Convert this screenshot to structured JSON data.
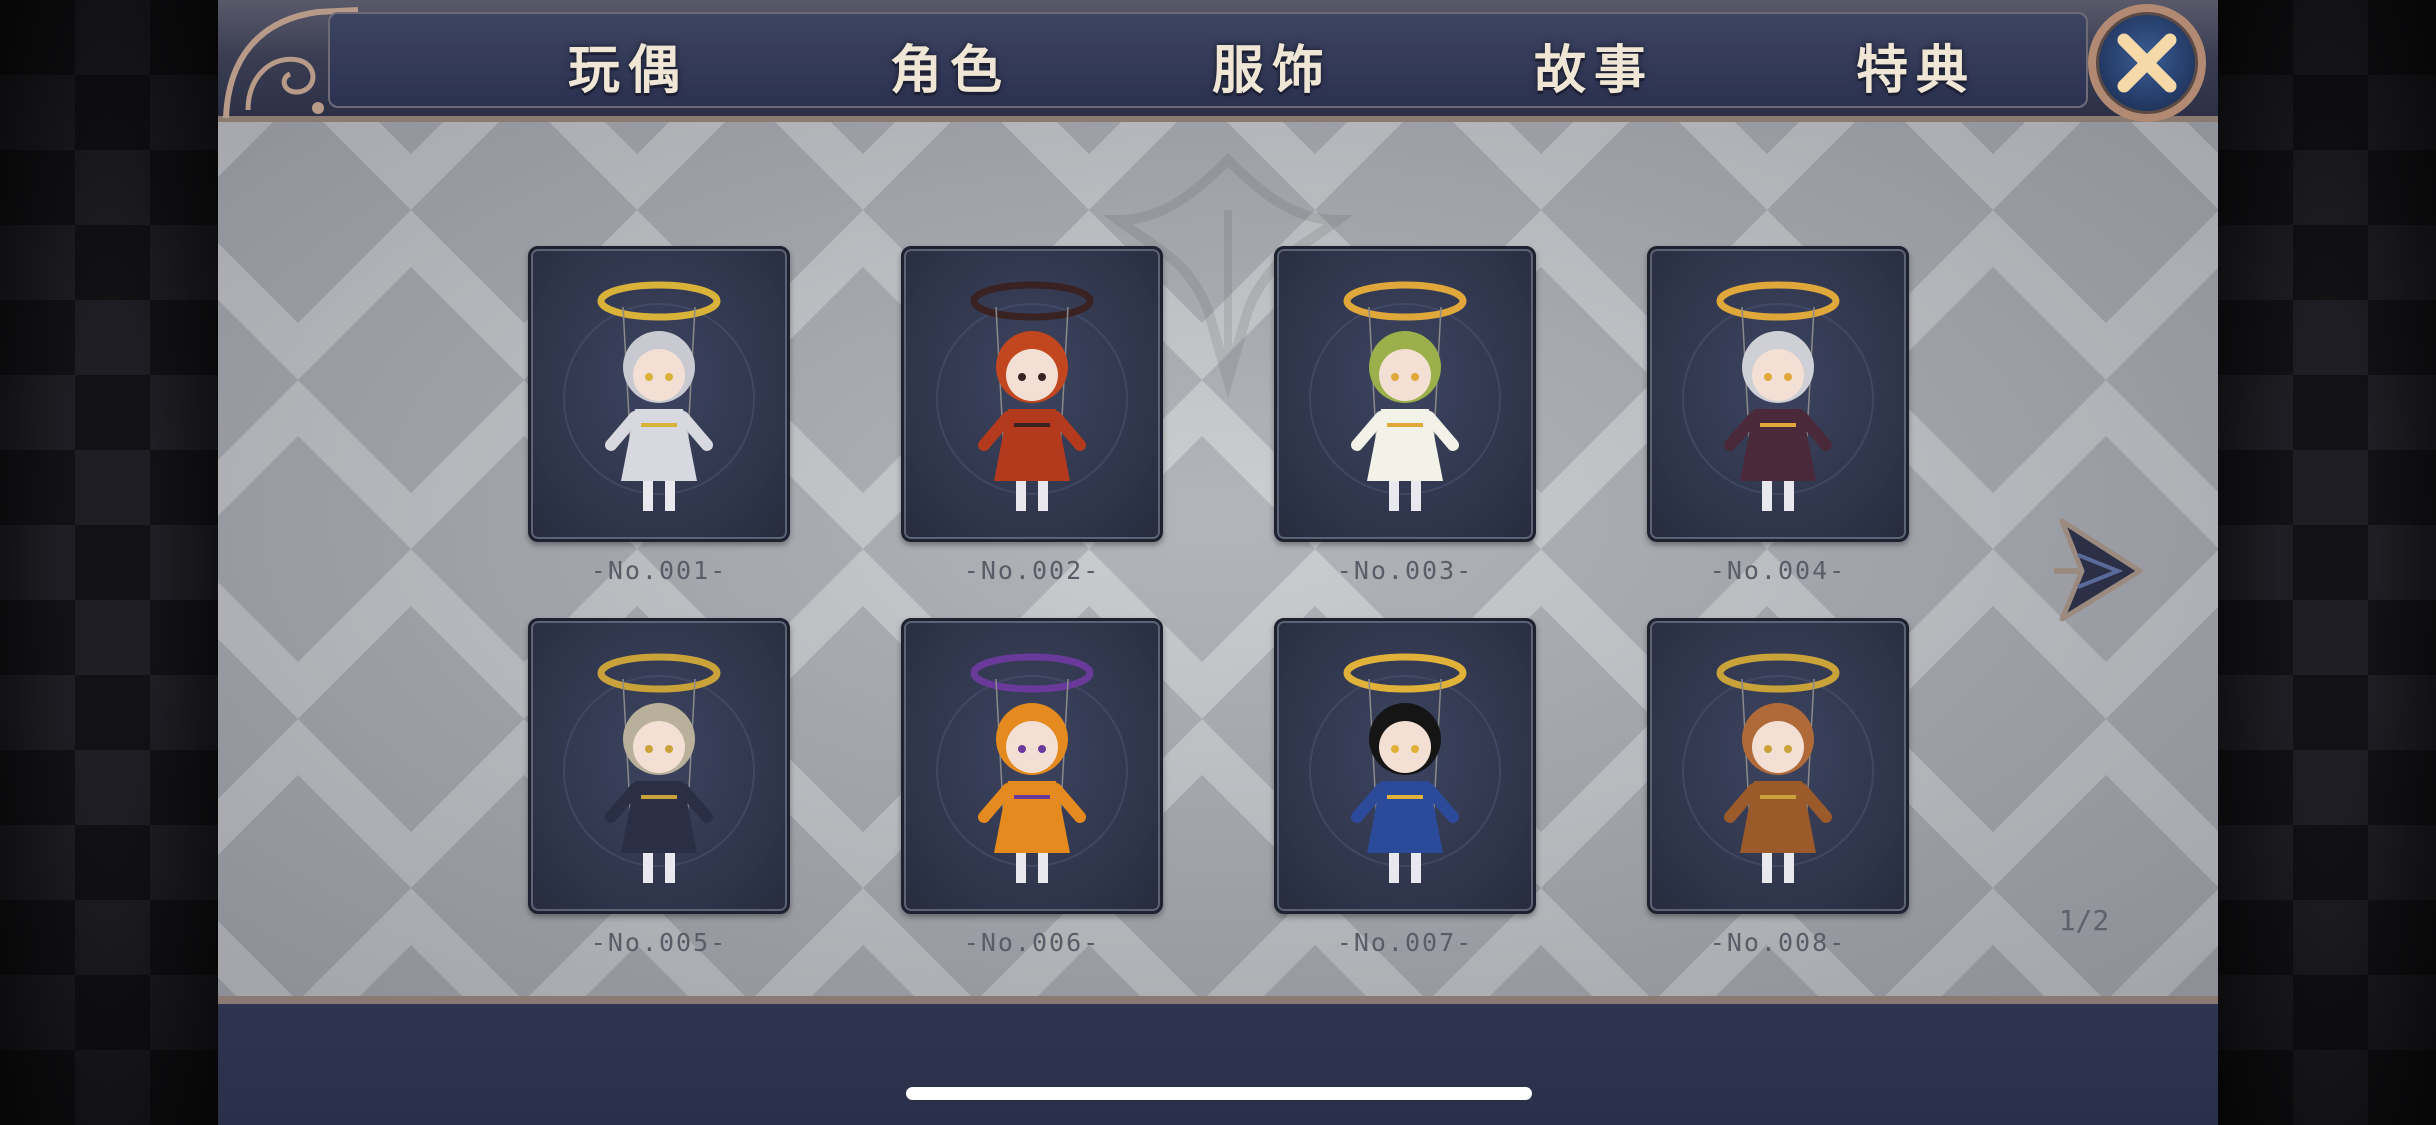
{
  "tabs": [
    {
      "label": "玩偶"
    },
    {
      "label": "角色"
    },
    {
      "label": "服饰"
    },
    {
      "label": "故事"
    },
    {
      "label": "特典"
    }
  ],
  "close_icon": "close-icon",
  "dolls": [
    {
      "label": "-No.001-",
      "palette": {
        "main": "#d8d8e0",
        "accent": "#d9b23a",
        "hair": "#c9c9d2"
      }
    },
    {
      "label": "-No.002-",
      "palette": {
        "main": "#b33a1c",
        "accent": "#3a2222",
        "hair": "#c2461f"
      }
    },
    {
      "label": "-No.003-",
      "palette": {
        "main": "#f2f2e8",
        "accent": "#e0a83a",
        "hair": "#9bb04a"
      }
    },
    {
      "label": "-No.004-",
      "palette": {
        "main": "#4a2a3a",
        "accent": "#e0a83a",
        "hair": "#cfcfd6"
      }
    },
    {
      "label": "-No.005-",
      "palette": {
        "main": "#2b2f45",
        "accent": "#c9a23a",
        "hair": "#b8b09a"
      }
    },
    {
      "label": "-No.006-",
      "palette": {
        "main": "#e48a1f",
        "accent": "#6a3a9a",
        "hair": "#e48a1f"
      }
    },
    {
      "label": "-No.007-",
      "palette": {
        "main": "#2b4a9a",
        "accent": "#e0b23a",
        "hair": "#151515"
      }
    },
    {
      "label": "-No.008-",
      "palette": {
        "main": "#9a5a2a",
        "accent": "#c9a23a",
        "hair": "#b06a3a"
      }
    }
  ],
  "pagination": {
    "current": 1,
    "total": 2,
    "text": "1/2"
  },
  "next_icon": "chevron-right-icon",
  "colors": {
    "panel": "#c5c7cb",
    "card": "#2e3449",
    "frame": "#8b7a74",
    "tab_text": "#efe6d6"
  }
}
